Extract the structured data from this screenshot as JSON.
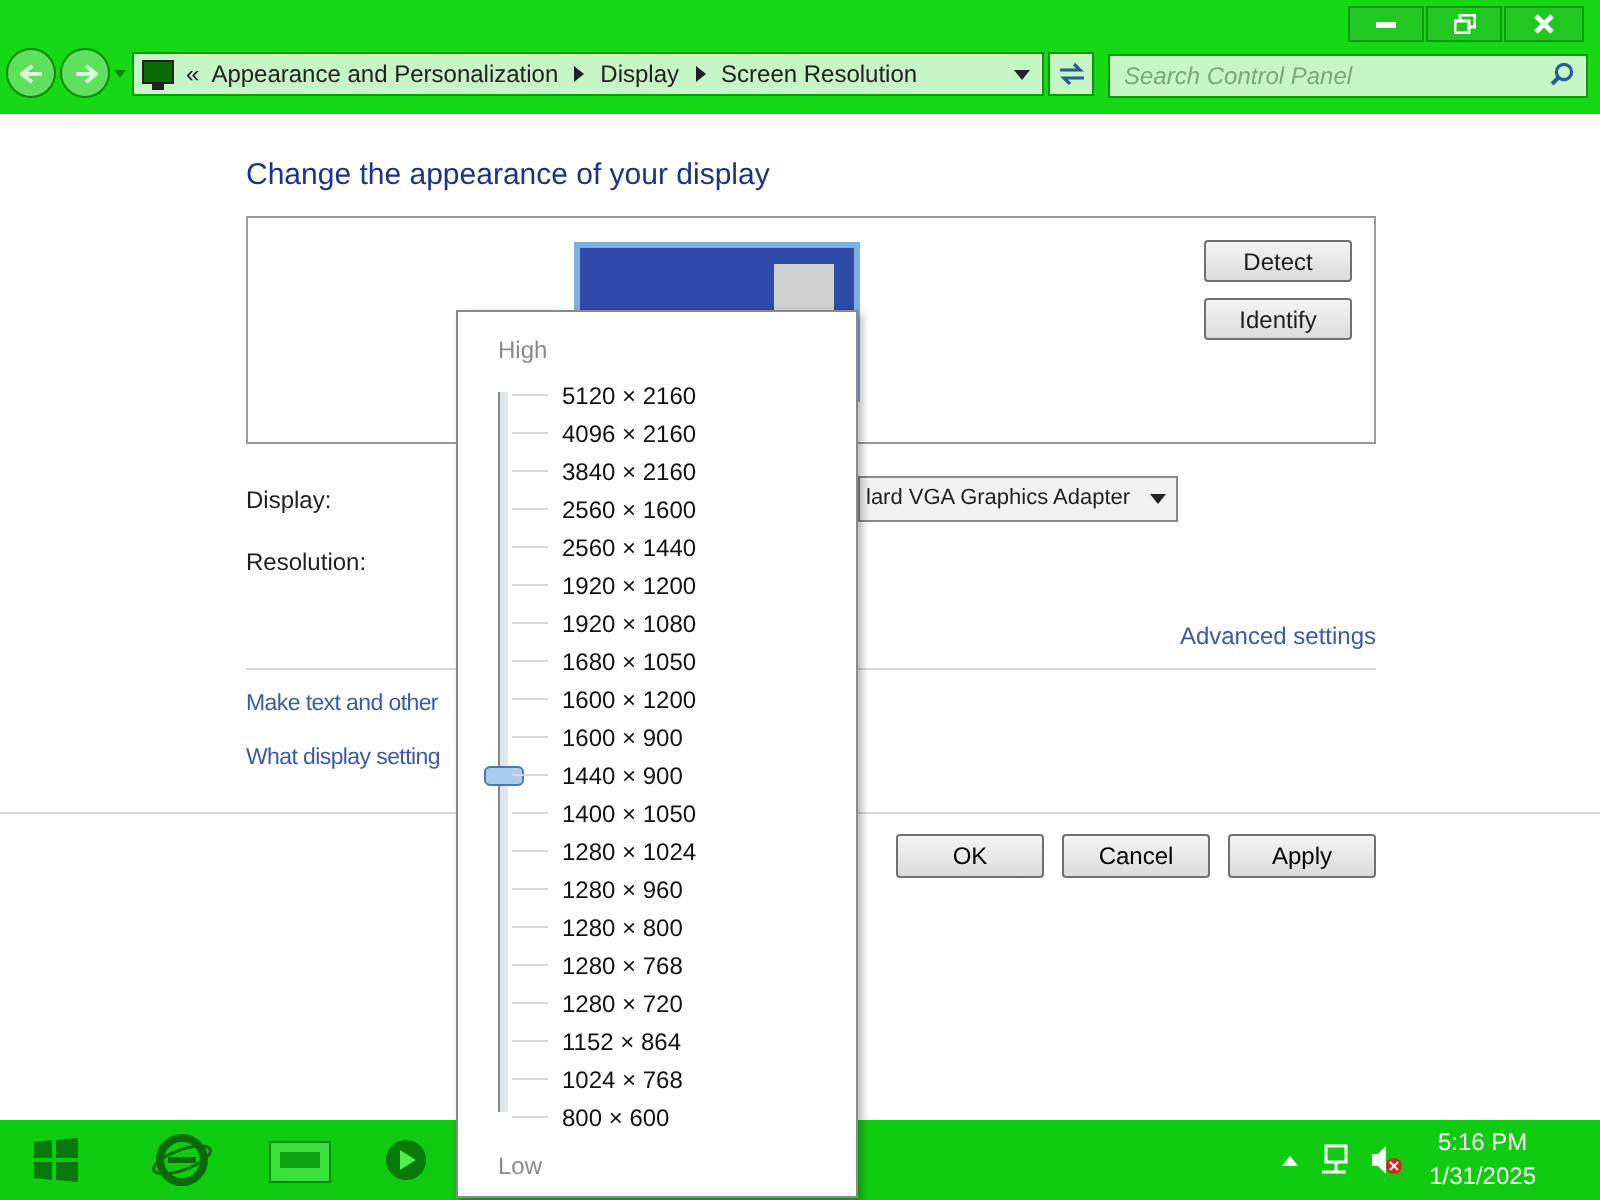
{
  "address_bar": {
    "prefix": "«",
    "crumbs": [
      "Appearance and Personalization",
      "Display",
      "Screen Resolution"
    ]
  },
  "search": {
    "placeholder": "Search Control Panel"
  },
  "heading": "Change the appearance of your display",
  "preview_buttons": [
    "Detect",
    "Identify"
  ],
  "display": {
    "label": "Display:",
    "value": "lard VGA Graphics Adapter"
  },
  "resolution": {
    "label": "Resolution:"
  },
  "advanced_link": "Advanced settings",
  "links": [
    "Make text and other",
    "What display setting"
  ],
  "dialog_buttons": [
    "OK",
    "Cancel",
    "Apply"
  ],
  "resolution_popup": {
    "high_label": "High",
    "low_label": "Low",
    "level": 0.474,
    "options": [
      "5120 × 2160",
      "4096 × 2160",
      "3840 × 2160",
      "2560 × 1600",
      "2560 × 1440",
      "1920 × 1200",
      "1920 × 1080",
      "1680 × 1050",
      "1600 × 1200",
      "1600 × 900",
      "1440 × 900",
      "1400 × 1050",
      "1280 × 1024",
      "1280 × 960",
      "1280 × 800",
      "1280 × 768",
      "1280 × 720",
      "1152 × 864",
      "1024 × 768",
      "800 × 600"
    ]
  },
  "taskbar": {
    "time": "5:16 PM",
    "date": "1/31/2025"
  }
}
